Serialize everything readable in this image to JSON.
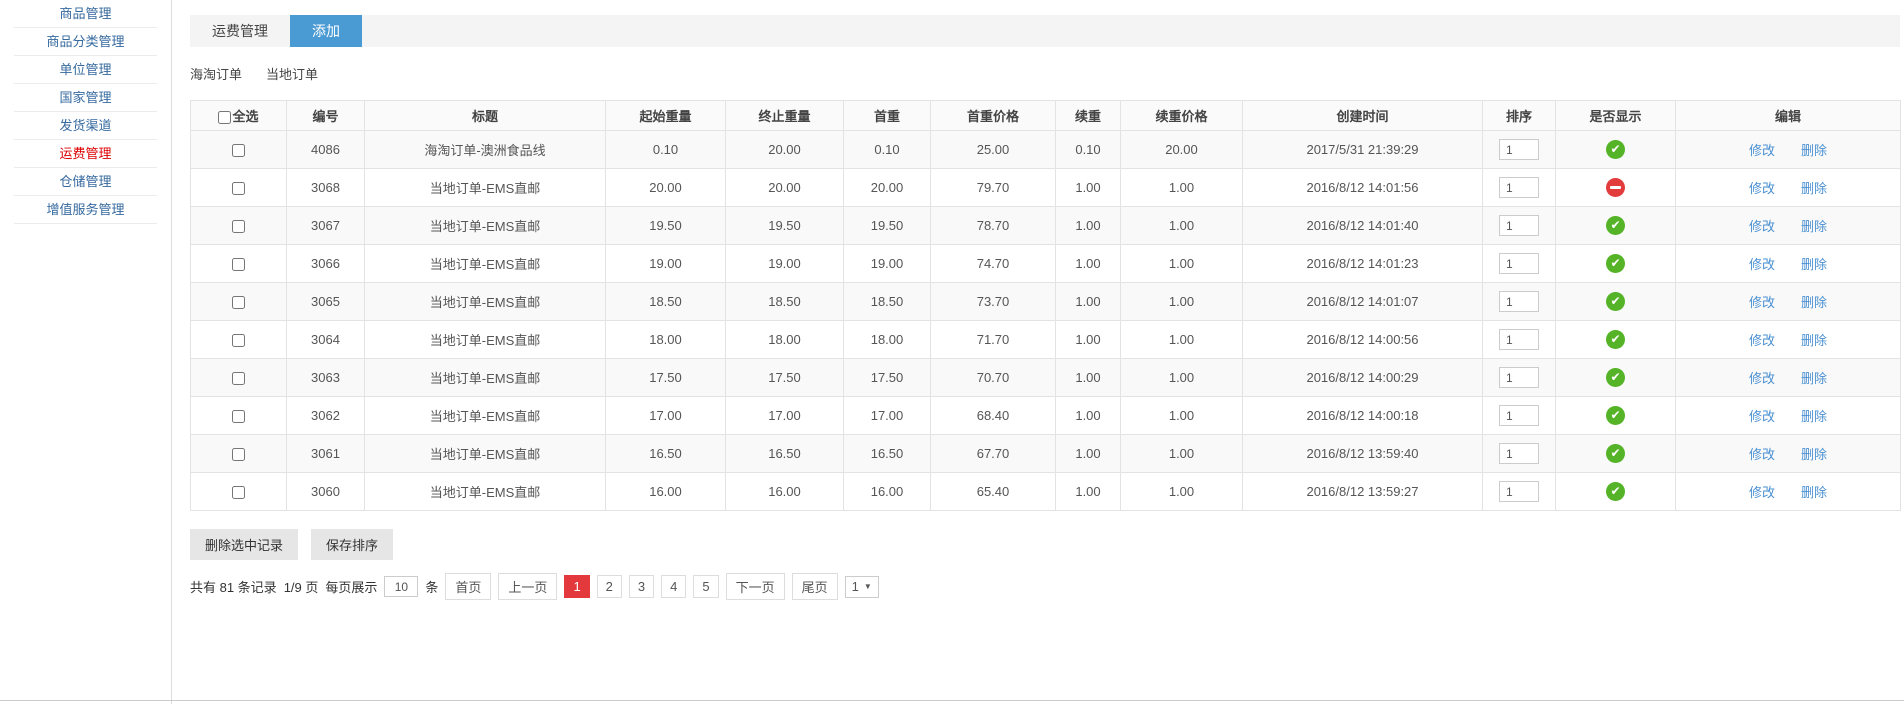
{
  "colors": {
    "accent_blue": "#4a9ad4",
    "sidebar_link": "#35699f",
    "sidebar_active_red": "#dd0000",
    "edit_link_blue": "#4a90d2",
    "status_green": "#55b327",
    "status_red": "#e23c3c",
    "pager_current_bg": "#e4393c"
  },
  "sidebar": {
    "items": [
      {
        "label": "商品管理",
        "active": false
      },
      {
        "label": "商品分类管理",
        "active": false
      },
      {
        "label": "单位管理",
        "active": false
      },
      {
        "label": "国家管理",
        "active": false
      },
      {
        "label": "发货渠道",
        "active": false
      },
      {
        "label": "运费管理",
        "active": true
      },
      {
        "label": "仓储管理",
        "active": false
      },
      {
        "label": "增值服务管理",
        "active": false
      }
    ]
  },
  "tabs": {
    "items": [
      {
        "label": "运费管理",
        "active": false
      },
      {
        "label": "添加",
        "active": true
      }
    ]
  },
  "subnav": {
    "links": [
      {
        "label": "海淘订单"
      },
      {
        "label": "当地订单"
      }
    ]
  },
  "table": {
    "headers": {
      "select_all": "全选",
      "id": "编号",
      "title": "标题",
      "start_weight": "起始重量",
      "end_weight": "终止重量",
      "first_weight": "首重",
      "first_price": "首重价格",
      "additional_weight": "续重",
      "additional_price": "续重价格",
      "created_at": "创建时间",
      "sort": "排序",
      "visible": "是否显示",
      "edit": "编辑"
    },
    "edit_labels": {
      "modify": "修改",
      "delete": "删除"
    },
    "rows": [
      {
        "id": "4086",
        "title": "海淘订单-澳洲食品线",
        "start_weight": "0.10",
        "end_weight": "20.00",
        "first_weight": "0.10",
        "first_price": "25.00",
        "additional_weight": "0.10",
        "additional_price": "20.00",
        "created_at": "2017/5/31 21:39:29",
        "sort": "1",
        "visible": true
      },
      {
        "id": "3068",
        "title": "当地订单-EMS直邮",
        "start_weight": "20.00",
        "end_weight": "20.00",
        "first_weight": "20.00",
        "first_price": "79.70",
        "additional_weight": "1.00",
        "additional_price": "1.00",
        "created_at": "2016/8/12 14:01:56",
        "sort": "1",
        "visible": false
      },
      {
        "id": "3067",
        "title": "当地订单-EMS直邮",
        "start_weight": "19.50",
        "end_weight": "19.50",
        "first_weight": "19.50",
        "first_price": "78.70",
        "additional_weight": "1.00",
        "additional_price": "1.00",
        "created_at": "2016/8/12 14:01:40",
        "sort": "1",
        "visible": true
      },
      {
        "id": "3066",
        "title": "当地订单-EMS直邮",
        "start_weight": "19.00",
        "end_weight": "19.00",
        "first_weight": "19.00",
        "first_price": "74.70",
        "additional_weight": "1.00",
        "additional_price": "1.00",
        "created_at": "2016/8/12 14:01:23",
        "sort": "1",
        "visible": true
      },
      {
        "id": "3065",
        "title": "当地订单-EMS直邮",
        "start_weight": "18.50",
        "end_weight": "18.50",
        "first_weight": "18.50",
        "first_price": "73.70",
        "additional_weight": "1.00",
        "additional_price": "1.00",
        "created_at": "2016/8/12 14:01:07",
        "sort": "1",
        "visible": true
      },
      {
        "id": "3064",
        "title": "当地订单-EMS直邮",
        "start_weight": "18.00",
        "end_weight": "18.00",
        "first_weight": "18.00",
        "first_price": "71.70",
        "additional_weight": "1.00",
        "additional_price": "1.00",
        "created_at": "2016/8/12 14:00:56",
        "sort": "1",
        "visible": true
      },
      {
        "id": "3063",
        "title": "当地订单-EMS直邮",
        "start_weight": "17.50",
        "end_weight": "17.50",
        "first_weight": "17.50",
        "first_price": "70.70",
        "additional_weight": "1.00",
        "additional_price": "1.00",
        "created_at": "2016/8/12 14:00:29",
        "sort": "1",
        "visible": true
      },
      {
        "id": "3062",
        "title": "当地订单-EMS直邮",
        "start_weight": "17.00",
        "end_weight": "17.00",
        "first_weight": "17.00",
        "first_price": "68.40",
        "additional_weight": "1.00",
        "additional_price": "1.00",
        "created_at": "2016/8/12 14:00:18",
        "sort": "1",
        "visible": true
      },
      {
        "id": "3061",
        "title": "当地订单-EMS直邮",
        "start_weight": "16.50",
        "end_weight": "16.50",
        "first_weight": "16.50",
        "first_price": "67.70",
        "additional_weight": "1.00",
        "additional_price": "1.00",
        "created_at": "2016/8/12 13:59:40",
        "sort": "1",
        "visible": true
      },
      {
        "id": "3060",
        "title": "当地订单-EMS直邮",
        "start_weight": "16.00",
        "end_weight": "16.00",
        "first_weight": "16.00",
        "first_price": "65.40",
        "additional_weight": "1.00",
        "additional_price": "1.00",
        "created_at": "2016/8/12 13:59:27",
        "sort": "1",
        "visible": true
      }
    ]
  },
  "actions": {
    "delete_selected": "删除选中记录",
    "save_sort": "保存排序"
  },
  "pagination": {
    "summary": "共有 81 条记录",
    "page_info": "1/9 页",
    "per_page_prefix": "每页展示",
    "per_page_value": "10",
    "per_page_suffix": "条",
    "first": "首页",
    "prev": "上一页",
    "pages": [
      "1",
      "2",
      "3",
      "4",
      "5"
    ],
    "current": "1",
    "next": "下一页",
    "last": "尾页",
    "jump_value": "1"
  }
}
